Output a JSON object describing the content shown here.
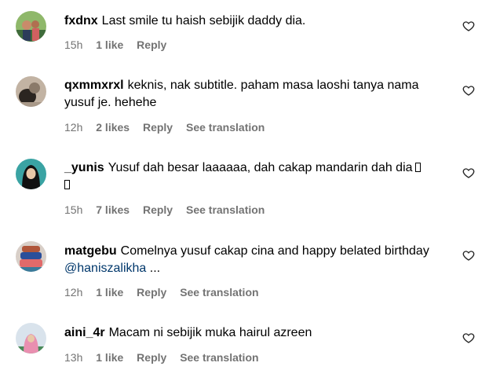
{
  "comments": [
    {
      "username": "fxdnx",
      "text": "Last smile tu haish sebijik daddy dia.",
      "time": "15h",
      "likes": "1 like",
      "reply": "Reply",
      "avatar_colors": [
        "#8fb86a",
        "#3f6b3a",
        "#c98b6a"
      ]
    },
    {
      "username": "qxmmxrxl",
      "text": "keknis, nak subtitle. paham masa laoshi tanya nama yusuf je. hehehe",
      "time": "12h",
      "likes": "2 likes",
      "reply": "Reply",
      "translate": "See translation",
      "avatar_colors": [
        "#c2b3a3",
        "#2b2520",
        "#8a7a6a"
      ]
    },
    {
      "username": "_yunis",
      "text": "Yusuf dah besar laaaaaa, dah cakap mandarin dah dia",
      "time": "15h",
      "likes": "7 likes",
      "reply": "Reply",
      "translate": "See translation",
      "avatar_colors": [
        "#3aa3a3",
        "#111111",
        "#e8c8a8"
      ]
    },
    {
      "username": "matgebu",
      "text": "Comelnya yusuf cakap cina and happy belated birthday",
      "mention": "@haniszalikha",
      "suffix": " ...",
      "time": "12h",
      "likes": "1 like",
      "reply": "Reply",
      "translate": "See translation",
      "avatar_colors": [
        "#b0563a",
        "#2a4f9a",
        "#e06a6a"
      ]
    },
    {
      "username": "aini_4r",
      "text": "Macam ni sebijik muka hairul azreen",
      "time": "13h",
      "likes": "1 like",
      "reply": "Reply",
      "translate": "See translation",
      "avatar_colors": [
        "#d9e3ec",
        "#e98fb0",
        "#4a8a5a"
      ]
    }
  ]
}
